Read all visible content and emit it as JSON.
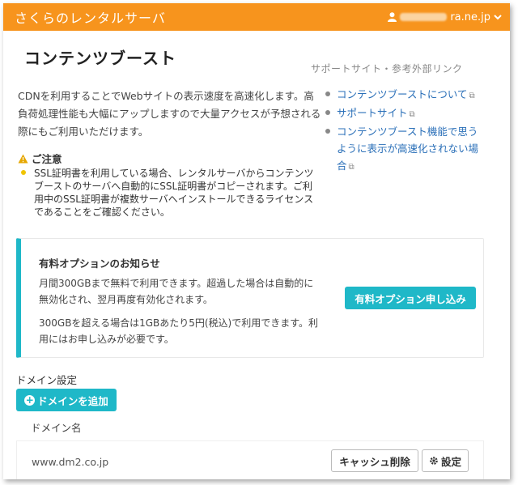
{
  "header": {
    "brand": "さくらのレンタルサーバ",
    "user_suffix": "ra.ne.jp",
    "user_icon": "person-icon",
    "dropdown_icon": "chevron-down-icon"
  },
  "page": {
    "title": "コンテンツブースト",
    "description": "CDNを利用することでWebサイトの表示速度を高速化します。高負荷処理性能も大幅にアップしますので大量アクセスが予想される際にもご利用いただけます。"
  },
  "notice": {
    "heading": "ご注意",
    "body": "SSL証明書を利用している場合、レンタルサーバからコンテンツブーストのサーバへ自動的にSSL証明書がコピーされます。ご利用中のSSL証明書が複数サーバへインストールできるライセンスであることをご確認ください。"
  },
  "support": {
    "heading": "サポートサイト・参考外部リンク",
    "links": [
      {
        "label": "コンテンツブーストについて"
      },
      {
        "label": "サポートサイト"
      },
      {
        "label": "コンテンツブースト機能で思うように表示が高速化されない場合"
      }
    ]
  },
  "paid_option": {
    "title": "有料オプションのお知らせ",
    "p1": "月間300GBまで無料で利用できます。超過した場合は自動的に無効化され、翌月再度有効化されます。",
    "p2": "300GBを超える場合は1GBあたり5円(税込)で利用できます。利用にはお申し込みが必要です。",
    "button": "有料オプション申し込み"
  },
  "domains": {
    "heading": "ドメイン設定",
    "add_button": "ドメインを追加",
    "column_header": "ドメイン名",
    "rows": [
      {
        "domain": "www.dm2.co.jp",
        "cache_button": "キャッシュ削除",
        "settings_button": "設定"
      }
    ]
  },
  "colors": {
    "topbar": "#f7941d",
    "accent": "#1fb8c8",
    "link": "#2a6fb8"
  }
}
